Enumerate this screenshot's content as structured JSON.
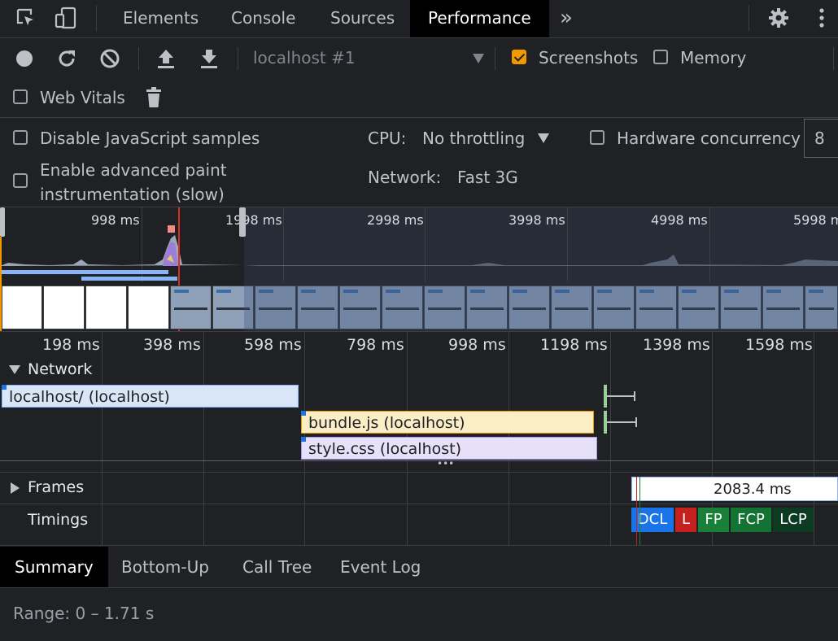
{
  "tabs": {
    "elements": "Elements",
    "console": "Console",
    "sources": "Sources",
    "performance": "Performance",
    "more": "»"
  },
  "toolbar": {
    "target": "localhost #1",
    "screenshots": "Screenshots",
    "memory": "Memory",
    "web_vitals": "Web Vitals",
    "screenshots_checked": true,
    "memory_checked": false,
    "web_vitals_checked": false
  },
  "settings": {
    "disable_js_samples": "Disable JavaScript samples",
    "advanced_paint_line1": "Enable advanced paint",
    "advanced_paint_line2": "instrumentation (slow)",
    "cpu_label": "CPU:",
    "cpu_value": "No throttling",
    "network_label": "Network:",
    "network_value": "Fast 3G",
    "hardware_concurrency": "Hardware concurrency",
    "hardware_concurrency_value": "8"
  },
  "overview": {
    "ticks": [
      "998 ms",
      "1998 ms",
      "2998 ms",
      "3998 ms",
      "4998 ms",
      "5998 ms"
    ]
  },
  "ruler": {
    "ticks": [
      "198 ms",
      "398 ms",
      "598 ms",
      "798 ms",
      "998 ms",
      "1198 ms",
      "1398 ms",
      "1598 ms"
    ]
  },
  "network": {
    "title": "Network",
    "requests": [
      {
        "label": "localhost/ (localhost)",
        "color": "#d9e6f8"
      },
      {
        "label": "bundle.js (localhost)",
        "color": "#fbeec6"
      },
      {
        "label": "style.css (localhost)",
        "color": "#e6e0f8"
      }
    ]
  },
  "tracks": {
    "frames": "Frames",
    "frame_duration": "2083.4 ms",
    "timings": "Timings",
    "markers": [
      {
        "label": "DCL",
        "color": "#1a73e8"
      },
      {
        "label": "L",
        "color": "#c5221f"
      },
      {
        "label": "FP",
        "color": "#188038"
      },
      {
        "label": "FCP",
        "color": "#137333"
      },
      {
        "label": "LCP",
        "color": "#0d3b22"
      }
    ]
  },
  "bottom_tabs": {
    "summary": "Summary",
    "bottom_up": "Bottom-Up",
    "call_tree": "Call Tree",
    "event_log": "Event Log"
  },
  "summary": {
    "range": "Range: 0 – 1.71 s"
  }
}
